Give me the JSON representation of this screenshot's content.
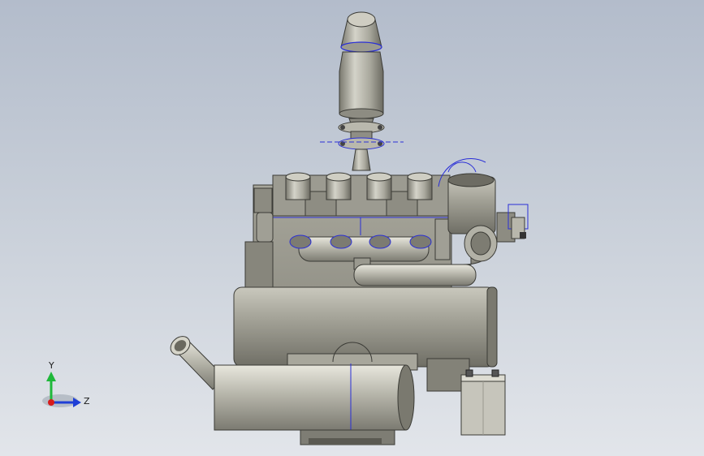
{
  "viewport": {
    "background_top": "#b3bccb",
    "background_bottom": "#e2e5ea"
  },
  "triad": {
    "y_label": "Y",
    "z_label": "Z",
    "y_color": "#1fb83a",
    "z_color": "#1f3fd6",
    "x_color": "#d81b1b"
  },
  "model": {
    "body_color": "#9e9d92",
    "shadow_color": "#6d6c63",
    "sketch_color": "#2a2fd6"
  }
}
